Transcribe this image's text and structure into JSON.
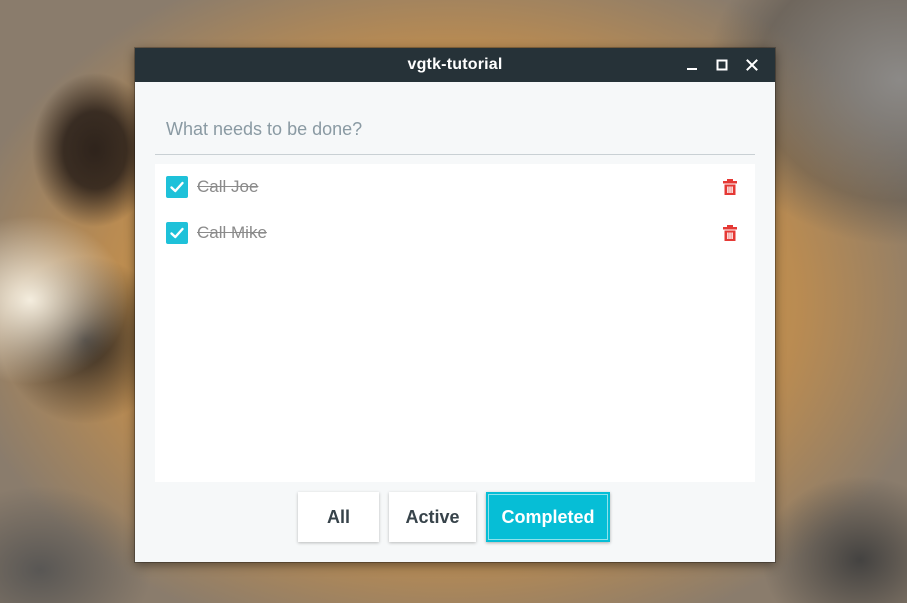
{
  "window": {
    "title": "vgtk-tutorial",
    "controls": [
      "minimize-icon",
      "maximize-icon",
      "close-icon"
    ]
  },
  "entry": {
    "placeholder": "What needs to be done?",
    "value": ""
  },
  "todos": [
    {
      "label": "Call Joe",
      "done": true
    },
    {
      "label": "Call Mike",
      "done": true
    }
  ],
  "filters": {
    "all_label": "All",
    "active_label": "Active",
    "completed_label": "Completed",
    "selected": "Completed"
  },
  "colors": {
    "accent": "#06bed6",
    "titlebar": "#263238",
    "delete": "#e53935",
    "done_text": "#8b8b8b"
  },
  "icons": {
    "check": "checkmark-icon",
    "delete": "trash-icon"
  }
}
